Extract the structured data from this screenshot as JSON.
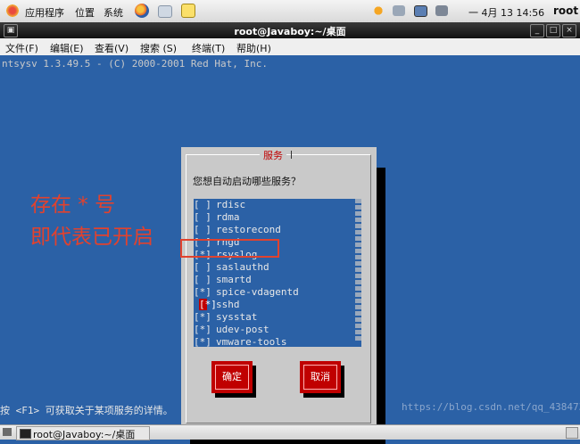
{
  "panel": {
    "apps_label": "应用程序",
    "places_label": "位置",
    "system_label": "系统",
    "clock": "一 4月 13 14:56",
    "user": "root",
    "icons": [
      "firefox-icon",
      "mail-icon",
      "notes-icon",
      "update-icon",
      "network-icon",
      "display-icon",
      "volume-icon"
    ]
  },
  "window": {
    "title": "root@Javaboy:~/桌面"
  },
  "menu": [
    "文件(F)",
    "编辑(E)",
    "查看(V)",
    "搜索 (S)",
    "终端(T)",
    "帮助(H)"
  ],
  "terminal": {
    "header": "ntsysv 1.3.49.5 - (C) 2000-2001 Red Hat, Inc.",
    "footer": "按 <F1> 可获取关于某项服务的详情。",
    "watermark": "https://blog.csdn.net/qq_43847359"
  },
  "dialog": {
    "title": "服务",
    "prompt": "您想自动启动哪些服务？",
    "services": [
      {
        "mark": "[ ]",
        "name": "rdisc"
      },
      {
        "mark": "[ ]",
        "name": "rdma"
      },
      {
        "mark": "[ ]",
        "name": "restorecond"
      },
      {
        "mark": "[ ]",
        "name": "rngd"
      },
      {
        "mark": "[*]",
        "name": "rsyslog"
      },
      {
        "mark": "[ ]",
        "name": "saslauthd"
      },
      {
        "mark": "[ ]",
        "name": "smartd"
      },
      {
        "mark": "[*]",
        "name": "spice-vdagentd"
      },
      {
        "mark": "[*]",
        "name": "sshd",
        "selected": true
      },
      {
        "mark": "[*]",
        "name": "sysstat"
      },
      {
        "mark": "[*]",
        "name": "udev-post"
      },
      {
        "mark": "[*]",
        "name": "vmware-tools"
      }
    ],
    "ok_label": "确定",
    "cancel_label": "取消"
  },
  "annotation": {
    "line1": "存在 * 号",
    "line2": "即代表已开启",
    "color": "#e1422e"
  },
  "taskbar": {
    "task_label": "root@Javaboy:~/桌面"
  }
}
